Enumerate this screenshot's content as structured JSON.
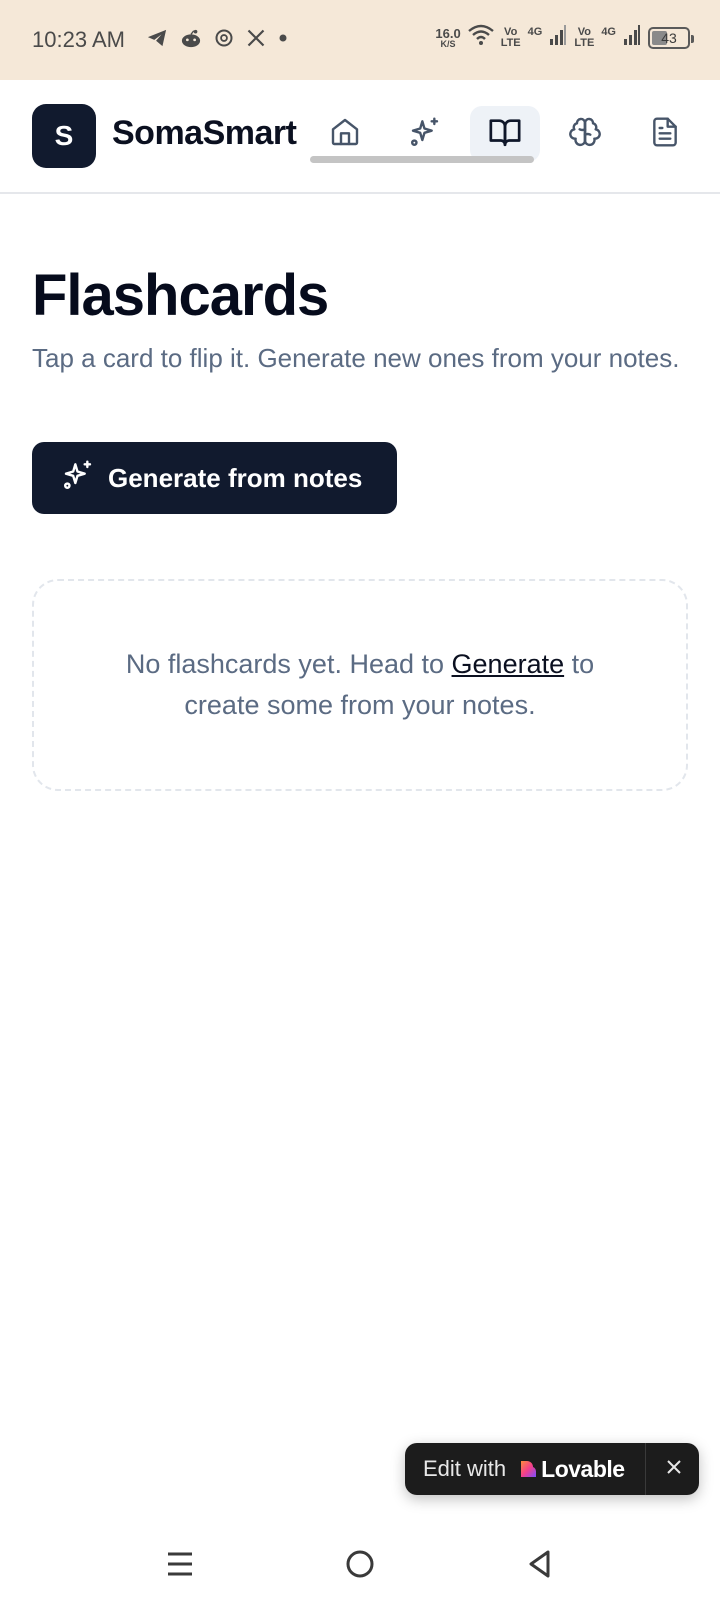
{
  "status_bar": {
    "time": "10:23 AM",
    "network_speed": "16.0",
    "network_speed_unit": "K/S",
    "volte_1": "Vo",
    "volte_1b": "LTE",
    "signal_1_label": "4G",
    "volte_2": "Vo",
    "volte_2b": "LTE",
    "signal_2_label": "4G",
    "battery_level": "43",
    "battery_fraction": 0.43,
    "app_icons": [
      "telegram-icon",
      "reddit-icon",
      "threads-icon",
      "x-icon",
      "dot-icon"
    ]
  },
  "header": {
    "logo_letter": "S",
    "brand": "SomaSmart",
    "nav": [
      {
        "icon": "home-icon",
        "active": false
      },
      {
        "icon": "sparkles-icon",
        "active": false
      },
      {
        "icon": "book-open-icon",
        "active": true
      },
      {
        "icon": "brain-icon",
        "active": false
      },
      {
        "icon": "file-text-icon",
        "active": false
      }
    ]
  },
  "main": {
    "title": "Flashcards",
    "subtitle": "Tap a card to flip it. Generate new ones from your notes.",
    "generate_button": "Generate from notes",
    "empty_state": {
      "before": "No flashcards yet. Head to ",
      "link": "Generate",
      "after": " to create some from your notes."
    }
  },
  "lovable_badge": {
    "label": "Edit with",
    "brand": "Lovable"
  },
  "colors": {
    "status_bar_bg": "#f5e8d8",
    "primary": "#111a2e",
    "muted_text": "#5b6b83",
    "active_nav_bg": "#eef2f7"
  }
}
